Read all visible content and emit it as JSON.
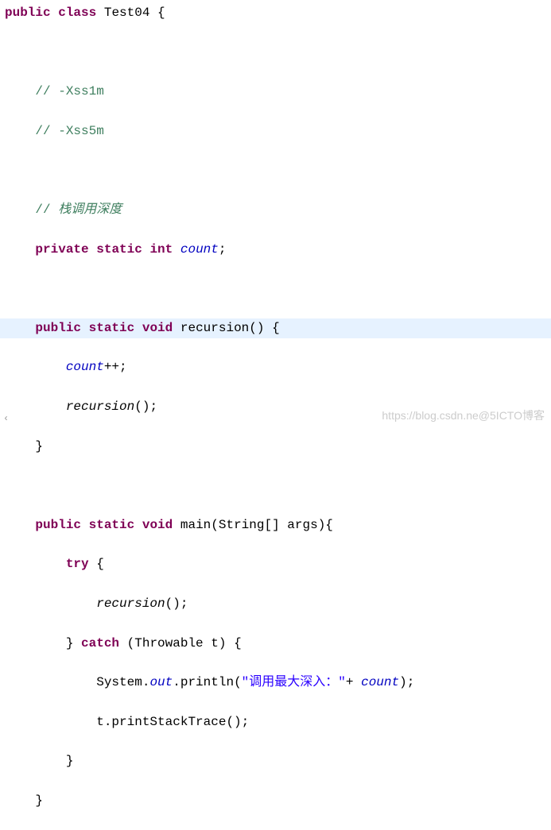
{
  "code": {
    "kw_public": "public",
    "kw_class": "class",
    "kw_private": "private",
    "kw_static": "static",
    "kw_int": "int",
    "kw_void": "void",
    "kw_try": "try",
    "kw_catch": "catch",
    "class_name": "Test04",
    "comment1": "// -Xss1m",
    "comment2": "// -Xss5m",
    "comment3_prefix": "// ",
    "comment3_text": "栈调用深度",
    "field_count": "count",
    "method_recursion": "recursion",
    "method_main": "main",
    "param_main": "String[] args",
    "exc_type": "Throwable t",
    "sys_out": "System.",
    "out_field": "out",
    "println": ".println(",
    "string_literal": "\"调用最大深入：\"",
    "plus": "+ ",
    "t_method": "t.printStackTrace();",
    "open_brace": " {",
    "close_brace": "}",
    "semicolon": ";",
    "plusplus": "++;",
    "call_suffix": "();",
    "paren_open": "() {",
    "paren_args_close": "){"
  },
  "watermark": "https://blog.csdn.ne@5ICTO博客",
  "caret": "‹"
}
